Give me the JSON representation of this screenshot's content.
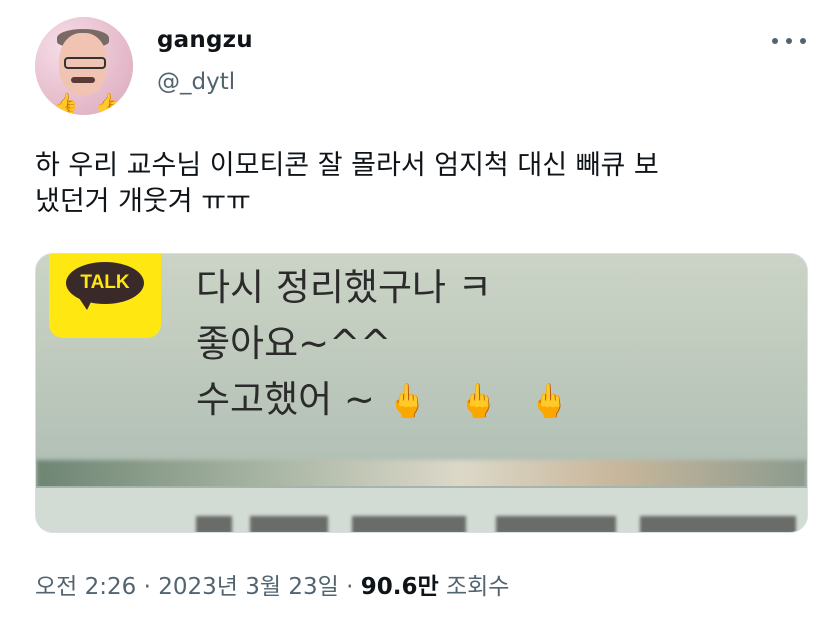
{
  "author": {
    "display_name": "gangzu",
    "handle": "@_dytl",
    "avatar_emoji": "👍"
  },
  "menu_icon": "more-horizontal-icon",
  "tweet": {
    "text": "하 우리 교수님 이모티콘 잘 몰라서 엄지척 대신 빼큐 보\n냈던거 개웃겨 ㅠㅠ"
  },
  "media": {
    "app_badge": "TALK",
    "lines": [
      "다시 정리했구나 ㅋ",
      "좋아요~^^",
      "수고했어 ~"
    ],
    "emoji": "🖕🖕🖕"
  },
  "meta": {
    "time": "오전 2:26",
    "separator": "·",
    "date": "2023년 3월 23일",
    "views_count": "90.6만",
    "views_label": "조회수"
  }
}
